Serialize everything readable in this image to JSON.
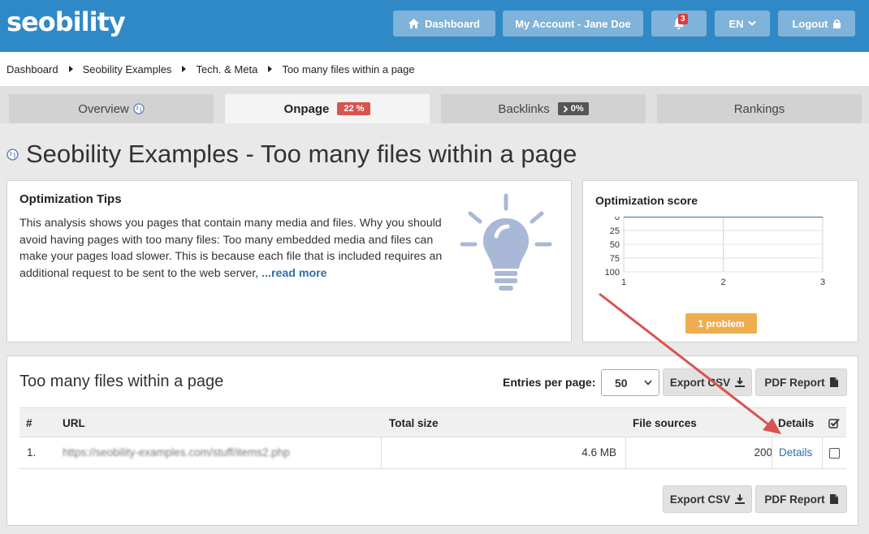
{
  "header": {
    "logo": "seobility",
    "dashboard_label": "Dashboard",
    "account_label": "My Account - Jane Doe",
    "notifications_count": "3",
    "language_label": "EN",
    "logout_label": "Logout"
  },
  "breadcrumb": [
    "Dashboard",
    "Seobility Examples",
    "Tech. & Meta",
    "Too many files within a page"
  ],
  "tabs": [
    {
      "label": "Overview",
      "badge": ""
    },
    {
      "label": "Onpage",
      "badge": "22 %"
    },
    {
      "label": "Backlinks",
      "badge": "0%"
    },
    {
      "label": "Rankings",
      "badge": ""
    }
  ],
  "page_title": "Seobility Examples - Too many files within a page",
  "tips": {
    "title": "Optimization Tips",
    "text": "This analysis shows you pages that contain many media and files. Why you should avoid having pages with too many files: Too many embedded media and files can make your pages load slower. This is because each file that is included requires an additional request to be sent to the web server,",
    "read_more": "...read more"
  },
  "score": {
    "title": "Optimization score",
    "problem_label": "1 problem"
  },
  "chart_data": {
    "type": "line",
    "title": "",
    "x": [
      1,
      2,
      3
    ],
    "series": [
      {
        "values": [
          0,
          0,
          0
        ]
      }
    ],
    "y_ticks": [
      "0",
      "25",
      "50",
      "75",
      "100"
    ],
    "x_ticks": [
      "1",
      "2",
      "3"
    ],
    "ylim": [
      0,
      100
    ],
    "y_inverted": true,
    "grid": true
  },
  "list": {
    "title": "Too many files within a page",
    "entries_label": "Entries per page:",
    "entries_value": "50",
    "export_csv_label": "Export CSV",
    "pdf_report_label": "PDF Report",
    "columns": [
      "#",
      "URL",
      "Total size",
      "File sources",
      "Details"
    ],
    "rows": [
      {
        "num": "1.",
        "url": "https://seobility-examples.com/stuff/items2.php",
        "total_size": "4.6 MB",
        "file_sources": "200",
        "details": "Details"
      }
    ]
  },
  "colors": {
    "brand": "#2f89c7",
    "onpage_badge": "#d9534f",
    "backlinks_badge": "#555555",
    "problem": "#f0ad4e",
    "annotation_arrow": "#d9534f",
    "link": "#2f6fa8"
  }
}
